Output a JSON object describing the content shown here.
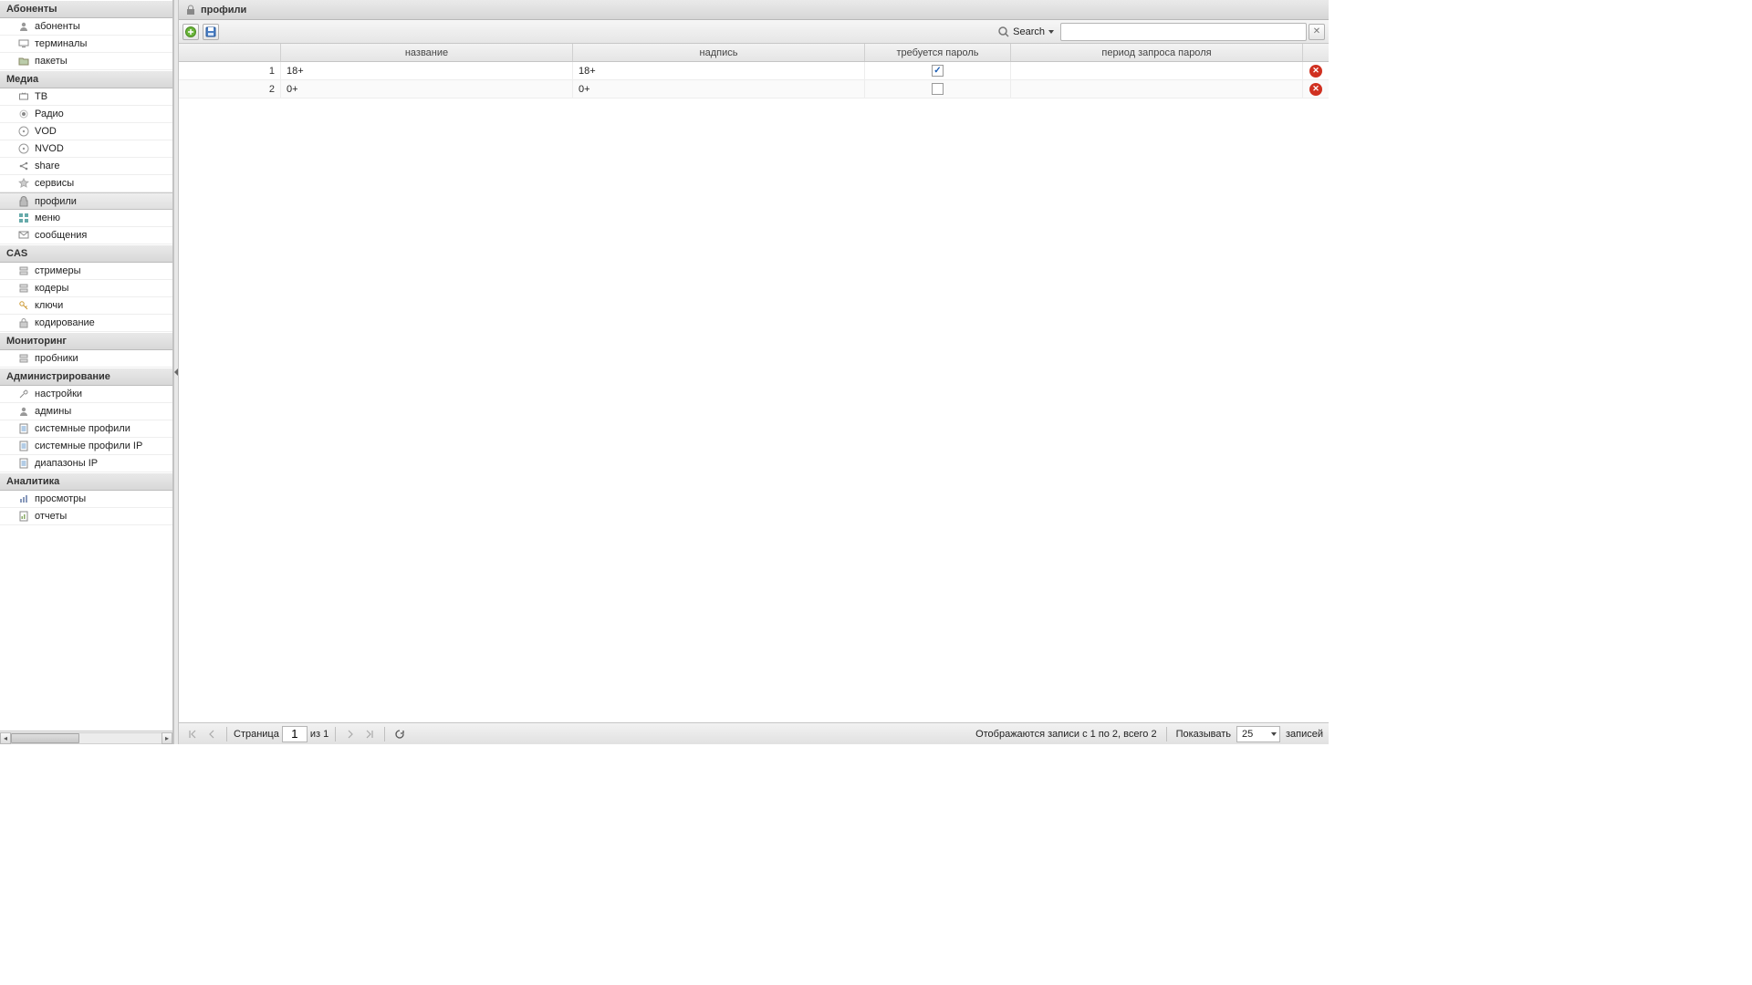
{
  "sidebar": {
    "groups": [
      {
        "title": "Абоненты",
        "items": [
          {
            "label": "абоненты",
            "icon": "user-icon",
            "active": false
          },
          {
            "label": "терминалы",
            "icon": "monitor-icon",
            "active": false
          },
          {
            "label": "пакеты",
            "icon": "folder-icon",
            "active": false
          }
        ]
      },
      {
        "title": "Медиа",
        "items": [
          {
            "label": "ТВ",
            "icon": "tv-icon",
            "active": false
          },
          {
            "label": "Радио",
            "icon": "radio-icon",
            "active": false
          },
          {
            "label": "VOD",
            "icon": "disc-icon",
            "active": false
          },
          {
            "label": "NVOD",
            "icon": "disc-icon",
            "active": false
          },
          {
            "label": "share",
            "icon": "share-icon",
            "active": false
          },
          {
            "label": "сервисы",
            "icon": "star-icon",
            "active": false
          },
          {
            "label": "профили",
            "icon": "lock-icon",
            "active": true
          },
          {
            "label": "меню",
            "icon": "grid-icon",
            "active": false
          },
          {
            "label": "сообщения",
            "icon": "msg-icon",
            "active": false
          }
        ]
      },
      {
        "title": "CAS",
        "items": [
          {
            "label": "стримеры",
            "icon": "server-icon",
            "active": false
          },
          {
            "label": "кодеры",
            "icon": "server-icon",
            "active": false
          },
          {
            "label": "ключи",
            "icon": "key-icon",
            "active": false
          },
          {
            "label": "кодирование",
            "icon": "lock2-icon",
            "active": false
          }
        ]
      },
      {
        "title": "Мониторинг",
        "items": [
          {
            "label": "пробники",
            "icon": "server-icon",
            "active": false
          }
        ]
      },
      {
        "title": "Администрирование",
        "items": [
          {
            "label": "настройки",
            "icon": "tools-icon",
            "active": false
          },
          {
            "label": "админы",
            "icon": "user-icon",
            "active": false
          },
          {
            "label": "системные профили",
            "icon": "page-icon",
            "active": false
          },
          {
            "label": "системные профили IP",
            "icon": "page-icon",
            "active": false
          },
          {
            "label": "диапазоны IP",
            "icon": "page-icon",
            "active": false
          }
        ]
      },
      {
        "title": "Аналитика",
        "items": [
          {
            "label": "просмотры",
            "icon": "chart-icon",
            "active": false
          },
          {
            "label": "отчеты",
            "icon": "report-icon",
            "active": false
          }
        ]
      }
    ]
  },
  "header": {
    "title": "профили"
  },
  "toolbar": {
    "search_label": "Search",
    "search_value": ""
  },
  "grid": {
    "columns": {
      "number": "",
      "name": "название",
      "caption": "надпись",
      "password_required": "требуется пароль",
      "password_period": "период запроса пароля",
      "actions": ""
    },
    "rows": [
      {
        "num": "1",
        "name": "18+",
        "caption": "18+",
        "password_required": true,
        "password_period": ""
      },
      {
        "num": "2",
        "name": "0+",
        "caption": "0+",
        "password_required": false,
        "password_period": ""
      }
    ]
  },
  "paging": {
    "page_label": "Страница",
    "page_value": "1",
    "of_label": "из 1",
    "display_info": "Отображаются записи с 1 по 2, всего 2",
    "show_label": "Показывать",
    "page_size": "25",
    "records_label": "записей"
  }
}
